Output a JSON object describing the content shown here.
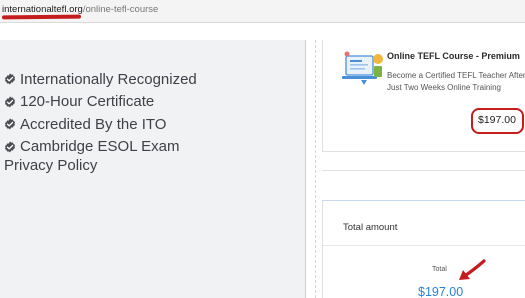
{
  "address_bar": {
    "domain": "internationaltefl.org",
    "path": "/online-tefl-course"
  },
  "features": [
    "Internationally Recognized",
    "120-Hour Certificate",
    "Accredited By the ITO",
    "Cambridge ESOL Exam"
  ],
  "privacy_link": "Privacy Policy",
  "order": {
    "course_title": "Online TEFL Course - Premium",
    "course_description": "Become a Certified TEFL Teacher After Just Two Weeks Online Training",
    "course_price": "$197.00",
    "thumbnail_icon": "laptop-course-illustration"
  },
  "total": {
    "heading": "Total amount",
    "label": "Total",
    "value": "$197.00"
  },
  "colors": {
    "annotation_red": "#c51d1d",
    "price_blue": "#2a82d6",
    "panel_gray": "#f1f2f4",
    "text_gray": "#3e4147"
  }
}
